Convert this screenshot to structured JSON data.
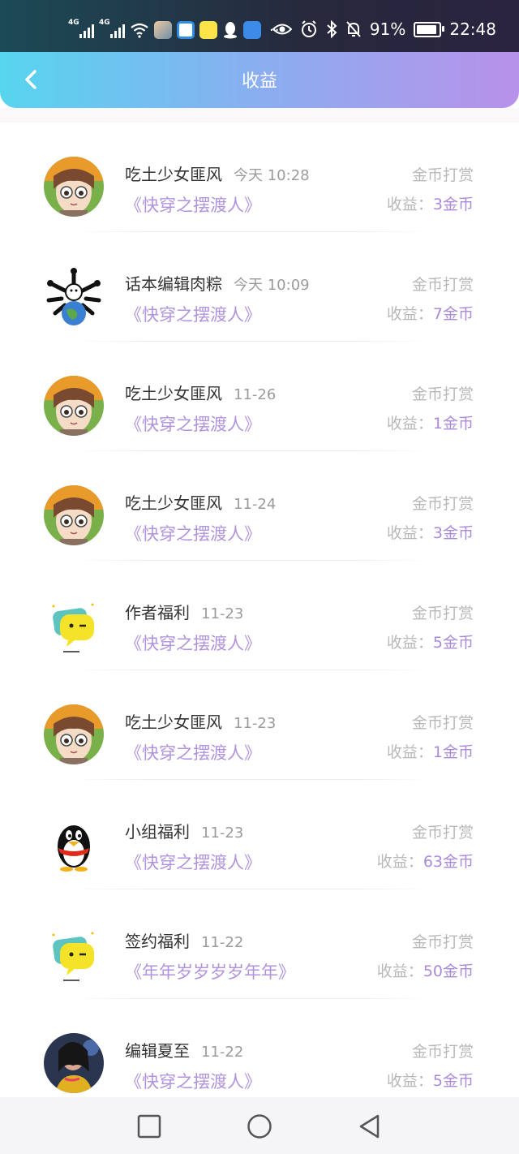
{
  "status_bar": {
    "net1": "4G",
    "net2": "4G",
    "battery_percent": "91%",
    "battery_level": 0.91,
    "time": "22:48",
    "more": "···"
  },
  "header": {
    "title": "收益"
  },
  "earnings": [
    {
      "name": "吃土少女匪风",
      "time": "今天 10:28",
      "book": "《快穿之摆渡人》",
      "type": "金币打赏",
      "label": "收益：",
      "amount": "3金币",
      "avatar": "anime-girl"
    },
    {
      "name": "话本编辑肉粽",
      "time": "今天 10:09",
      "book": "《快穿之摆渡人》",
      "type": "金币打赏",
      "label": "收益：",
      "amount": "7金币",
      "avatar": "earth-bones"
    },
    {
      "name": "吃土少女匪风",
      "time": "11-26",
      "book": "《快穿之摆渡人》",
      "type": "金币打赏",
      "label": "收益：",
      "amount": "1金币",
      "avatar": "anime-girl"
    },
    {
      "name": "吃土少女匪风",
      "time": "11-24",
      "book": "《快穿之摆渡人》",
      "type": "金币打赏",
      "label": "收益：",
      "amount": "3金币",
      "avatar": "anime-girl"
    },
    {
      "name": "作者福利",
      "time": "11-23",
      "book": "《快穿之摆渡人》",
      "type": "金币打赏",
      "label": "收益：",
      "amount": "5金币",
      "avatar": "yellow-bubble"
    },
    {
      "name": "吃土少女匪风",
      "time": "11-23",
      "book": "《快穿之摆渡人》",
      "type": "金币打赏",
      "label": "收益：",
      "amount": "1金币",
      "avatar": "anime-girl"
    },
    {
      "name": "小组福利",
      "time": "11-23",
      "book": "《快穿之摆渡人》",
      "type": "金币打赏",
      "label": "收益：",
      "amount": "63金币",
      "avatar": "penguin"
    },
    {
      "name": "签约福利",
      "time": "11-22",
      "book": "《年年岁岁岁岁年年》",
      "type": "金币打赏",
      "label": "收益：",
      "amount": "50金币",
      "avatar": "yellow-bubble"
    },
    {
      "name": "编辑夏至",
      "time": "11-22",
      "book": "《快穿之摆渡人》",
      "type": "金币打赏",
      "label": "收益：",
      "amount": "5金币",
      "avatar": "photo"
    }
  ]
}
